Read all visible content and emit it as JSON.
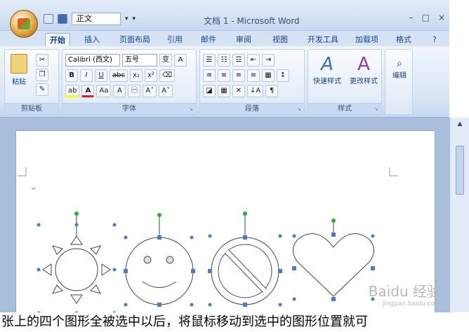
{
  "window": {
    "title": "文档 1 - Microsoft Word",
    "controls": [
      "–",
      "□",
      "×"
    ]
  },
  "qat": {
    "font_name": "正文"
  },
  "tabs": [
    {
      "label": "开始",
      "active": true
    },
    {
      "label": "插入",
      "active": false
    },
    {
      "label": "页面布局",
      "active": false
    },
    {
      "label": "引用",
      "active": false
    },
    {
      "label": "邮件",
      "active": false
    },
    {
      "label": "审阅",
      "active": false
    },
    {
      "label": "视图",
      "active": false
    },
    {
      "label": "开发工具",
      "active": false
    },
    {
      "label": "加载项",
      "active": false
    },
    {
      "label": "格式",
      "active": false
    }
  ],
  "ribbon": {
    "clipboard": {
      "label": "剪贴板",
      "paste": "粘贴"
    },
    "font": {
      "label": "字体",
      "font_name": "Calibri (西文)",
      "font_size": "五号"
    },
    "paragraph": {
      "label": "段落"
    },
    "styles": {
      "label": "样式",
      "quick_styles": "快速样式",
      "change_styles": "更改样式"
    },
    "editing": {
      "label": "编辑"
    }
  },
  "document": {
    "shapes": [
      "sun",
      "smiley-face",
      "no-symbol",
      "heart"
    ]
  },
  "bottom_caption": "张上的四个图形全被选中以后，将鼠标移动到选中的图形位置就可",
  "watermark": {
    "text": "Baidu 经验",
    "sub": "jingyan.baidu.com"
  }
}
